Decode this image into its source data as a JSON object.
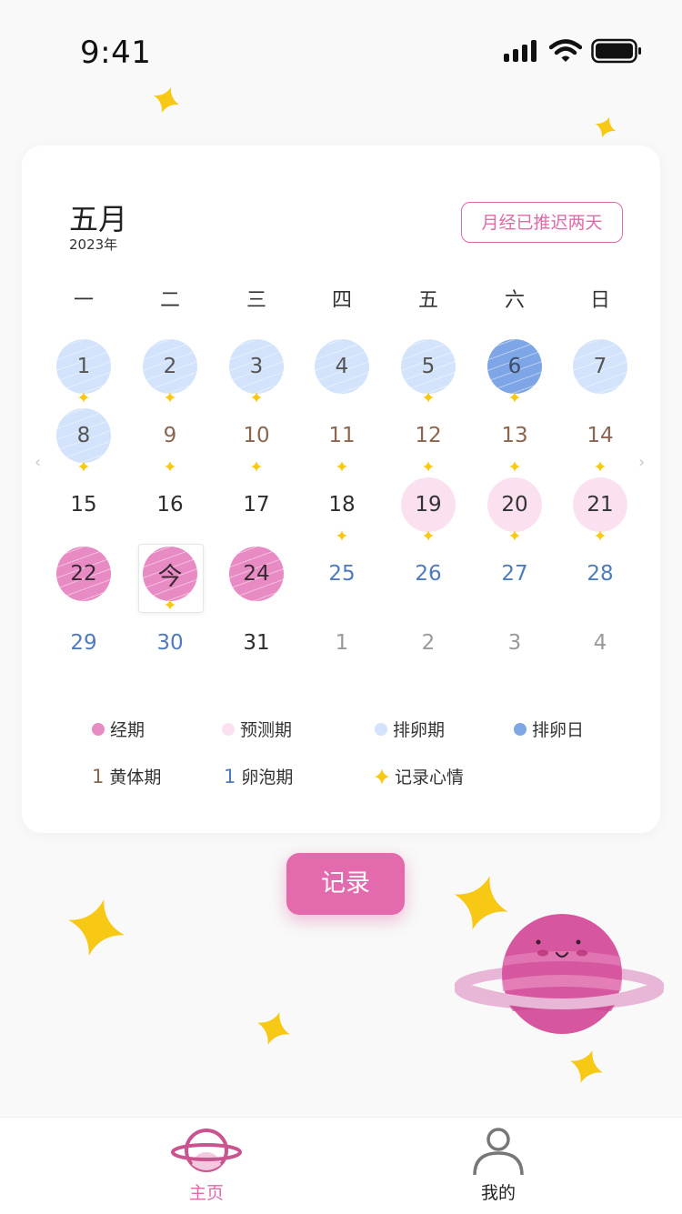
{
  "status_bar": {
    "time": "9:41"
  },
  "calendar": {
    "month": "五月",
    "year": "2023年",
    "notice": "月经已推迟两天",
    "weekdays": [
      "一",
      "二",
      "三",
      "四",
      "五",
      "六",
      "日"
    ],
    "days": [
      {
        "label": "1",
        "state": "ovulation",
        "sparkle": true
      },
      {
        "label": "2",
        "state": "ovulation",
        "sparkle": true
      },
      {
        "label": "3",
        "state": "ovulation",
        "sparkle": true
      },
      {
        "label": "4",
        "state": "ovulation",
        "sparkle": false
      },
      {
        "label": "5",
        "state": "ovulation",
        "sparkle": true
      },
      {
        "label": "6",
        "state": "ovulation-day",
        "sparkle": true
      },
      {
        "label": "7",
        "state": "ovulation",
        "sparkle": false
      },
      {
        "label": "8",
        "state": "ovulation",
        "sparkle": true
      },
      {
        "label": "9",
        "state": "luteal",
        "sparkle": true
      },
      {
        "label": "10",
        "state": "luteal",
        "sparkle": true
      },
      {
        "label": "11",
        "state": "luteal",
        "sparkle": true
      },
      {
        "label": "12",
        "state": "luteal",
        "sparkle": true
      },
      {
        "label": "13",
        "state": "luteal",
        "sparkle": true
      },
      {
        "label": "14",
        "state": "luteal",
        "sparkle": true
      },
      {
        "label": "15",
        "state": "normal",
        "sparkle": false
      },
      {
        "label": "16",
        "state": "normal",
        "sparkle": false
      },
      {
        "label": "17",
        "state": "normal",
        "sparkle": false
      },
      {
        "label": "18",
        "state": "normal",
        "sparkle": true
      },
      {
        "label": "19",
        "state": "predicted",
        "sparkle": true
      },
      {
        "label": "20",
        "state": "predicted",
        "sparkle": true
      },
      {
        "label": "21",
        "state": "predicted",
        "sparkle": true
      },
      {
        "label": "22",
        "state": "period",
        "sparkle": false
      },
      {
        "label": "今",
        "state": "period",
        "sparkle": true,
        "today": true
      },
      {
        "label": "24",
        "state": "period",
        "sparkle": false
      },
      {
        "label": "25",
        "state": "follicular",
        "sparkle": false
      },
      {
        "label": "26",
        "state": "follicular",
        "sparkle": false
      },
      {
        "label": "27",
        "state": "follicular",
        "sparkle": false
      },
      {
        "label": "28",
        "state": "follicular",
        "sparkle": false
      },
      {
        "label": "29",
        "state": "follicular",
        "sparkle": false
      },
      {
        "label": "30",
        "state": "follicular",
        "sparkle": false
      },
      {
        "label": "31",
        "state": "normal",
        "sparkle": false
      },
      {
        "label": "1",
        "state": "other-month",
        "sparkle": false
      },
      {
        "label": "2",
        "state": "other-month",
        "sparkle": false
      },
      {
        "label": "3",
        "state": "other-month",
        "sparkle": false
      },
      {
        "label": "4",
        "state": "other-month",
        "sparkle": false
      }
    ]
  },
  "legend": {
    "period": "经期",
    "predicted": "预测期",
    "ovulation": "排卵期",
    "ovulation_day": "排卵日",
    "luteal_mark": "1",
    "luteal": "黄体期",
    "follicular_mark": "1",
    "follicular": "卵泡期",
    "mood": "记录心情"
  },
  "record_button": "记录",
  "tabbar": {
    "home": "主页",
    "mine": "我的"
  },
  "colors": {
    "accent": "#e46aae",
    "period": "#e88ac4",
    "predicted": "#fbe1ef",
    "ovulation": "#d2e3fb",
    "ovulation_day": "#7ea6e6",
    "luteal_text": "#8a6650",
    "follicular_text": "#4e7bbd",
    "sparkle": "#f7c814"
  }
}
